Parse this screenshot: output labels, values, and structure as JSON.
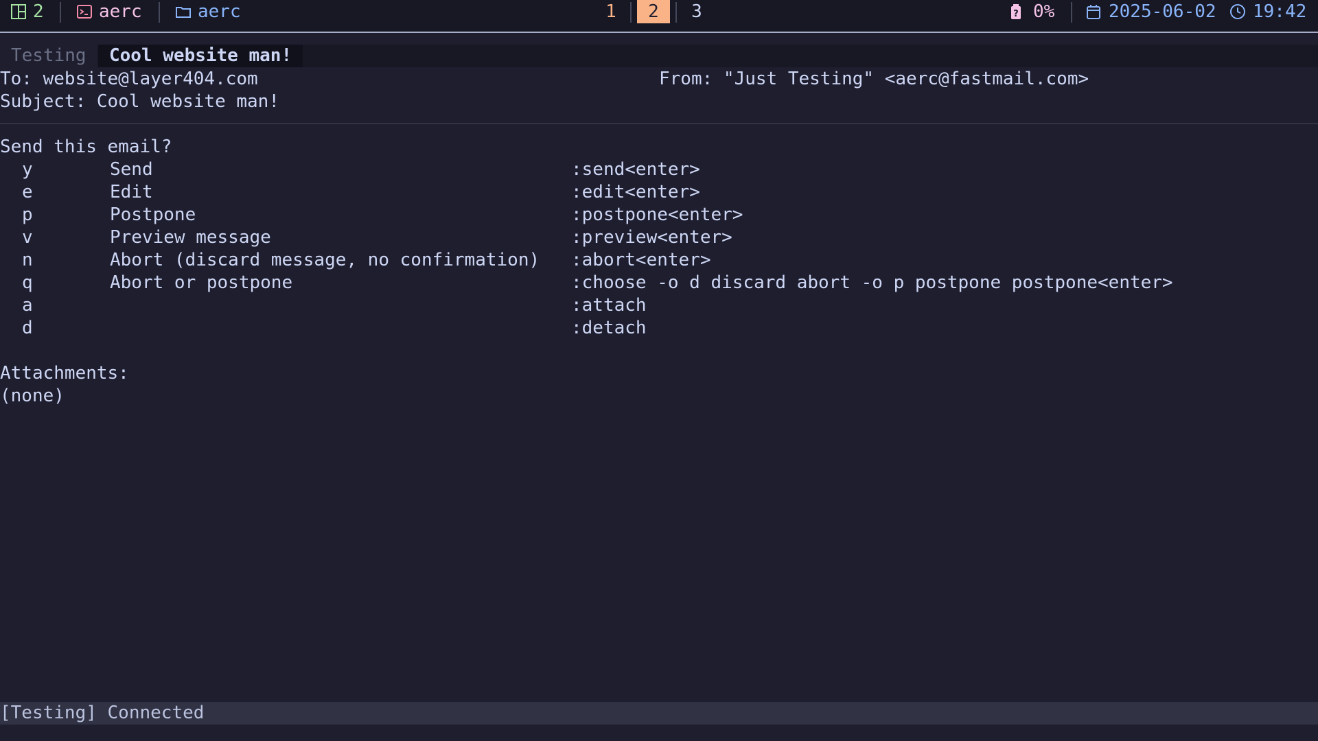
{
  "topbar": {
    "window_count": "2",
    "terminal_title": "aerc",
    "folder_title": "aerc",
    "workspaces": [
      "1",
      "2",
      "3"
    ],
    "active_workspace": "2",
    "battery": "0%",
    "date": "2025-06-02",
    "time": "19:42"
  },
  "tabs": [
    {
      "label": "Testing"
    },
    {
      "label": "Cool website man!"
    }
  ],
  "header": {
    "to": "To: website@layer404.com",
    "from": "From: \"Just Testing\" <aerc@fastmail.com>",
    "subject": "Subject: Cool website man!"
  },
  "review": {
    "prompt": "Send this email?",
    "options": [
      {
        "key": "y",
        "desc": "Send",
        "cmd": ":send<enter>"
      },
      {
        "key": "e",
        "desc": "Edit",
        "cmd": ":edit<enter>"
      },
      {
        "key": "p",
        "desc": "Postpone",
        "cmd": ":postpone<enter>"
      },
      {
        "key": "v",
        "desc": "Preview message",
        "cmd": ":preview<enter>"
      },
      {
        "key": "n",
        "desc": "Abort (discard message, no confirmation)",
        "cmd": ":abort<enter>"
      },
      {
        "key": "q",
        "desc": "Abort or postpone",
        "cmd": ":choose -o d discard abort -o p postpone postpone<enter>"
      },
      {
        "key": "a",
        "desc": "",
        "cmd": ":attach"
      },
      {
        "key": "d",
        "desc": "",
        "cmd": ":detach"
      }
    ],
    "attachments_label": "Attachments:",
    "attachments_value": "(none)"
  },
  "status": "[Testing] Connected",
  "colors": {
    "background": "#1e1e2e",
    "green": "#a6e3a1",
    "pink": "#f5c2e7",
    "peach": "#fab387",
    "blue": "#89b4fa"
  }
}
